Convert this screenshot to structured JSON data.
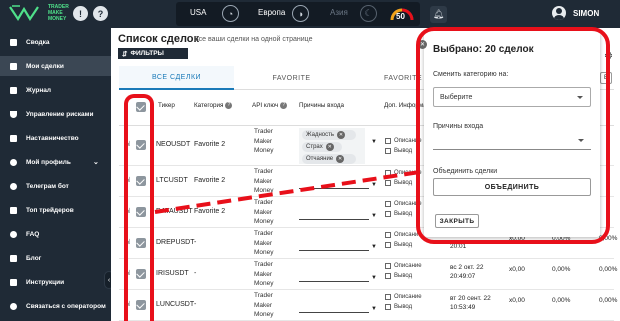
{
  "app": {
    "logo_text": "TRADER\nMAKE\nMONEY",
    "username": "SIMON",
    "gauge_value": "50"
  },
  "sessions": [
    {
      "label": "USA"
    },
    {
      "label": "Европа"
    },
    {
      "label": "Азия"
    }
  ],
  "sidebar": {
    "items": [
      {
        "label": "Сводка"
      },
      {
        "label": "Мои сделки",
        "active": true
      },
      {
        "label": "Журнал"
      },
      {
        "label": "Управление рисками"
      },
      {
        "label": "Наставничество"
      },
      {
        "label": "Мой профиль"
      },
      {
        "label": "Телеграм бот"
      },
      {
        "label": "Топ трейдеров"
      },
      {
        "label": "FAQ"
      },
      {
        "label": "Блог"
      },
      {
        "label": "Инструкции"
      },
      {
        "label": "Связаться с оператором"
      }
    ]
  },
  "page": {
    "title": "Список сделок",
    "subtitle": "Все ваши сделки на одной странице",
    "filters_label": "ФИЛЬТРЫ"
  },
  "tabs": [
    {
      "label": "ВСЕ СДЕЛКИ"
    },
    {
      "label": "FAVORITE"
    },
    {
      "label": "FAVORITE 2"
    }
  ],
  "table": {
    "headers": {
      "ticker": "Тикер",
      "category": "Категория",
      "api": "API ключ",
      "reasons": "Причины входа",
      "extra": "Доп. Информация"
    },
    "rows": [
      {
        "ticker": "NEOUSDT",
        "category": "Favorite 2",
        "api": [
          "Trader",
          "Maker",
          "Money"
        ],
        "reasons": [
          "Жадность",
          "Страх",
          "Отчаяние"
        ],
        "desc": "Описание",
        "out": "Вывод",
        "date": "",
        "amount": "",
        "pct1": "",
        "pct2": ""
      },
      {
        "ticker": "LTCUSDT",
        "category": "Favorite 2",
        "api": [
          "Trader",
          "Maker",
          "Money"
        ],
        "reasons": [],
        "desc": "Описание",
        "out": "Вывод",
        "date": "",
        "amount": "",
        "pct1": "",
        "pct2": ""
      },
      {
        "ticker": "DATAUSDT",
        "category": "Favorite 2",
        "api": [
          "Trader",
          "Maker",
          "Money"
        ],
        "reasons": [],
        "desc": "Описание",
        "out": "Вывод",
        "date": "",
        "amount": "",
        "pct1": "",
        "pct2": ""
      },
      {
        "ticker": "DREPUSDT",
        "category": "-",
        "api": [
          "Trader",
          "Maker",
          "Money"
        ],
        "reasons": [],
        "desc": "Описание",
        "out": "Вывод",
        "date": "20:01",
        "amount": "x0,00",
        "pct1": "0,00%",
        "pct2": "0,00%"
      },
      {
        "ticker": "IRISUSDT",
        "category": "-",
        "api": [
          "Trader",
          "Maker",
          "Money"
        ],
        "reasons": [],
        "desc": "Описание",
        "out": "Вывод",
        "date": "вс 2 окт. 22\n20:49:07",
        "amount": "x0,00",
        "pct1": "0,00%",
        "pct2": "0,00%"
      },
      {
        "ticker": "LUNCUSDT",
        "category": "-",
        "api": [
          "Trader",
          "Maker",
          "Money"
        ],
        "reasons": [],
        "desc": "Описание",
        "out": "Вывод",
        "date": "вт 20 сент. 22\n10:53:49",
        "amount": "x0,00",
        "pct1": "0,00%",
        "pct2": "0,00%"
      }
    ]
  },
  "popup": {
    "title": "Выбрано: 20 сделок",
    "category_label": "Сменить категорию на:",
    "category_value": "Выберите",
    "reasons_label": "Причины входа",
    "merge_label": "Объединить сделки",
    "merge_button": "ОБЪЕДИНИТЬ",
    "close_button": "ЗАКРЫТЬ"
  },
  "colors": {
    "sidebar": "#1f2a36",
    "accent": "#1a7ab8",
    "annotation": "#e8101a",
    "logo": "#4fe08a"
  }
}
